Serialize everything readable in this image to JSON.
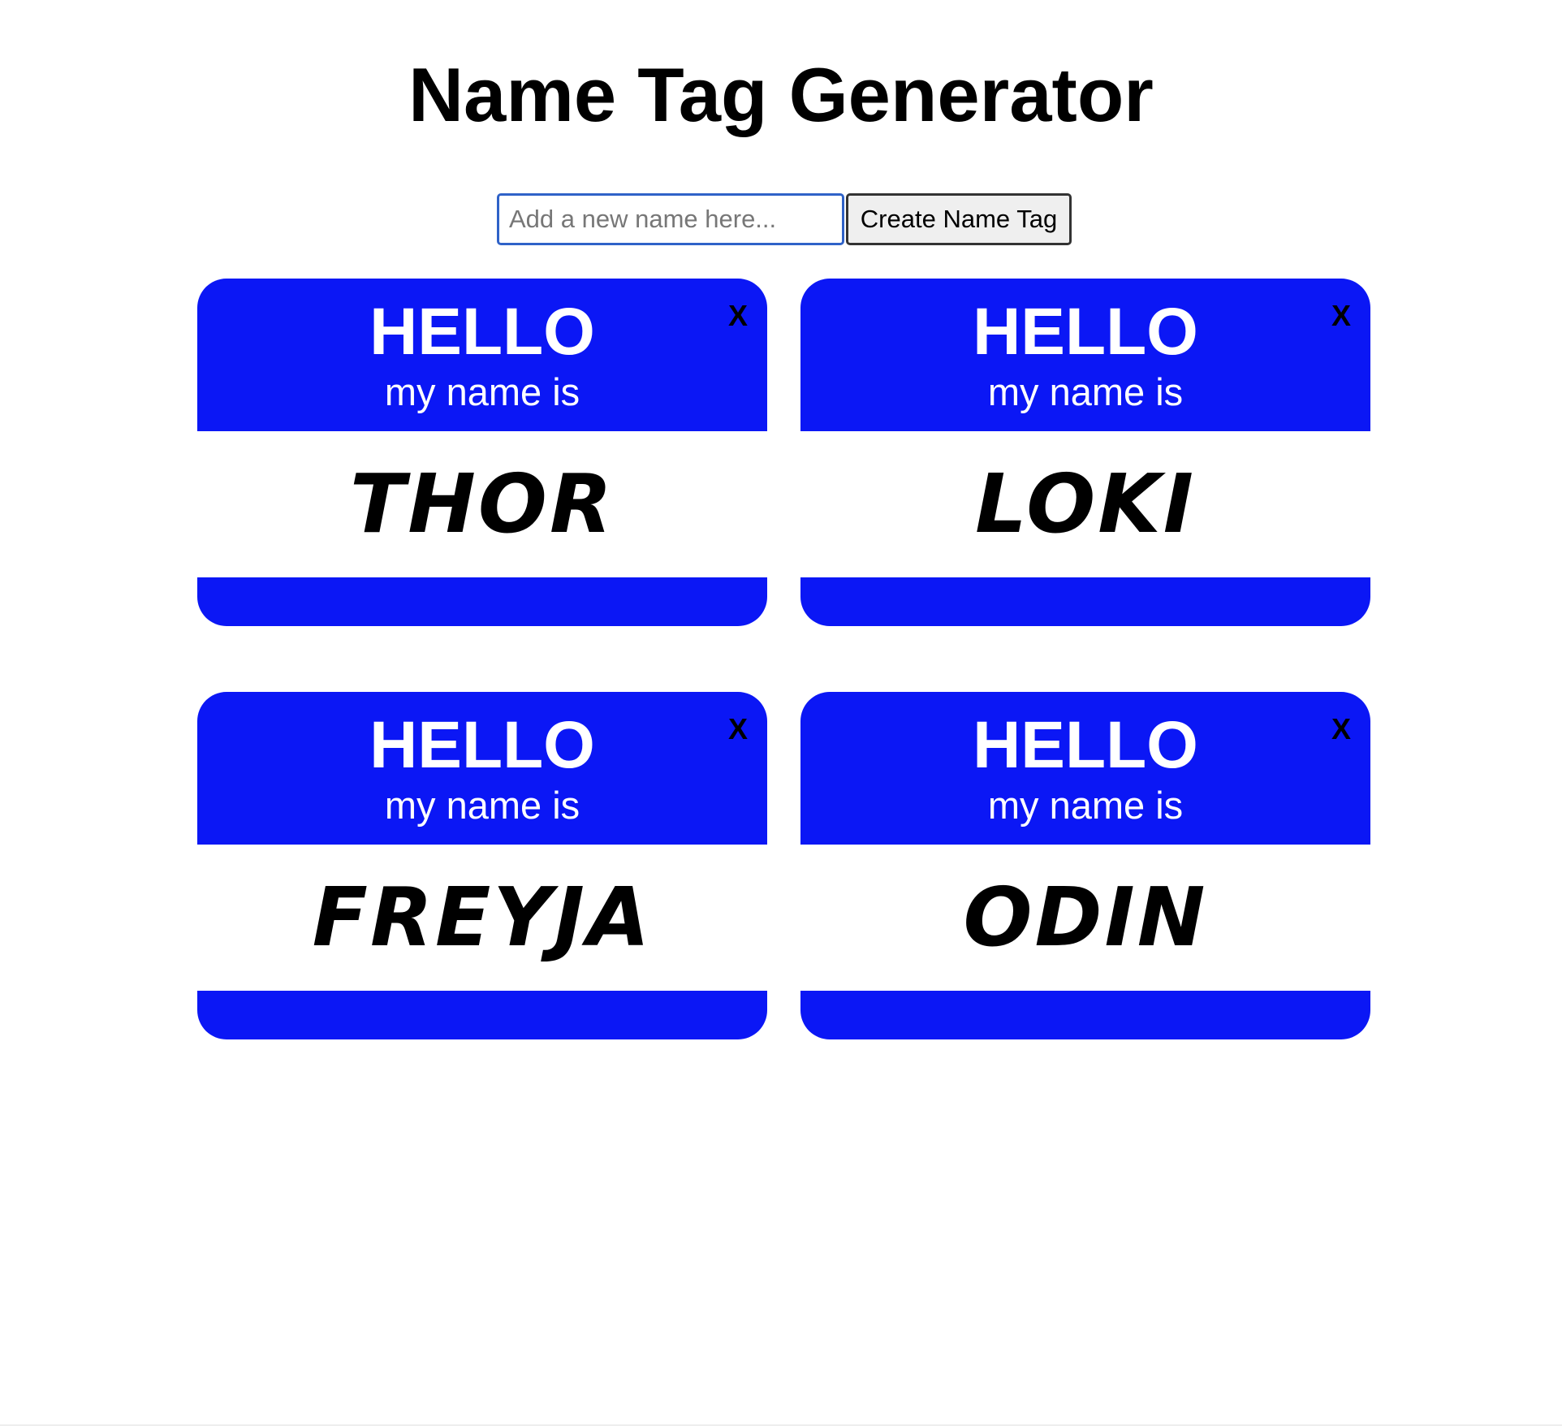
{
  "page": {
    "title": "Name Tag Generator"
  },
  "form": {
    "input_placeholder": "Add a new name here...",
    "input_value": "",
    "create_label": "Create Name Tag"
  },
  "colors": {
    "tag_blue": "#0b17f5",
    "input_border": "#2f62c8"
  },
  "tags": [
    {
      "hello": "HELLO",
      "subtitle": "my name is",
      "name": "THOR",
      "close": "X"
    },
    {
      "hello": "HELLO",
      "subtitle": "my name is",
      "name": "LOKI",
      "close": "X"
    },
    {
      "hello": "HELLO",
      "subtitle": "my name is",
      "name": "FREYJA",
      "close": "X"
    },
    {
      "hello": "HELLO",
      "subtitle": "my name is",
      "name": "ODIN",
      "close": "X"
    }
  ]
}
